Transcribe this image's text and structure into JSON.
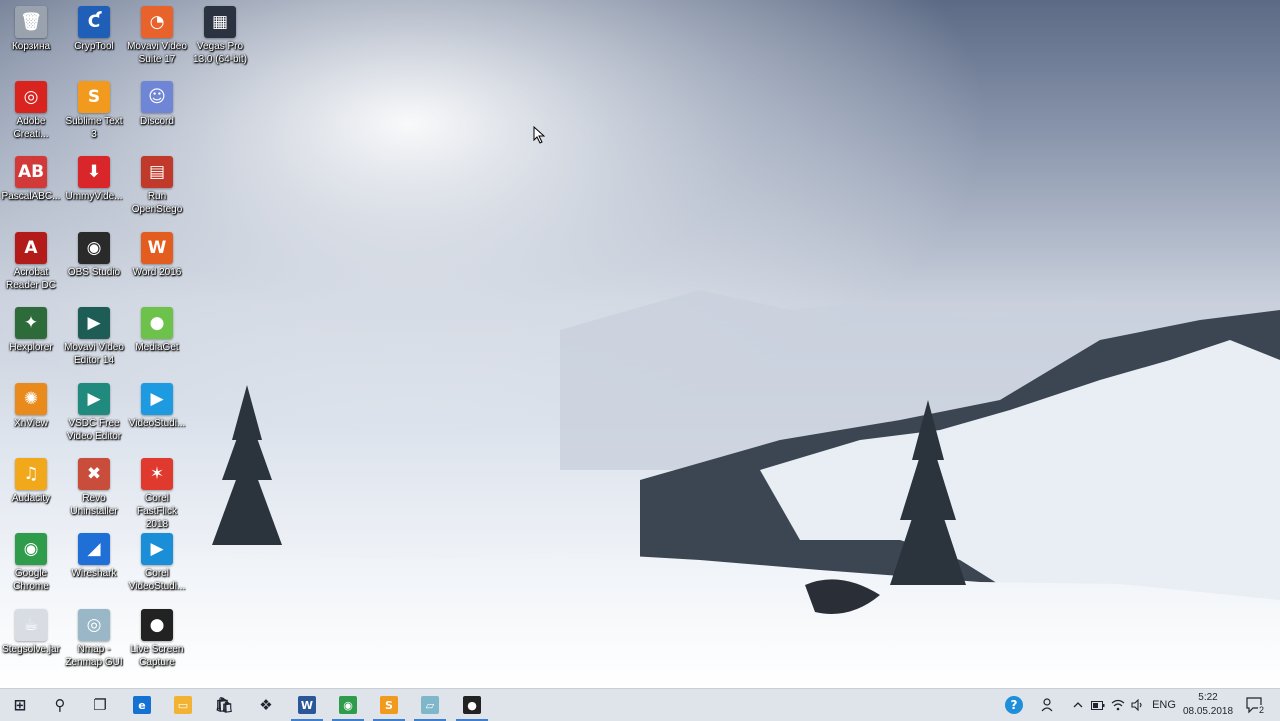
{
  "desktop": {
    "icons": [
      {
        "label": "Корзина",
        "glyph": "🗑",
        "color": "#9aa3ad",
        "icon": "recycle-bin-icon"
      },
      {
        "label": "CrypTool",
        "glyph": "Ƈ",
        "color": "#1f5fb8",
        "icon": "cryptool-icon"
      },
      {
        "label": "Movavi Video Suite 17",
        "glyph": "◔",
        "color": "#e8632c",
        "icon": "movavi-suite-icon"
      },
      {
        "label": "Vegas Pro 13.0 (64-bit)",
        "glyph": "▦",
        "color": "#2b3340",
        "icon": "vegas-pro-icon"
      },
      {
        "label": "Adobe Creati...",
        "glyph": "◎",
        "color": "#d9231f",
        "icon": "adobe-cc-icon"
      },
      {
        "label": "Sublime Text 3",
        "glyph": "S",
        "color": "#f29a1d",
        "icon": "sublime-text-icon"
      },
      {
        "label": "Discord",
        "glyph": "☺",
        "color": "#6f86d6",
        "icon": "discord-icon"
      },
      {
        "label": "PascalABC...",
        "glyph": "AB",
        "color": "#d23a3a",
        "icon": "pascalabc-icon"
      },
      {
        "label": "UmmyVide...",
        "glyph": "⬇",
        "color": "#d8262b",
        "icon": "ummy-video-icon"
      },
      {
        "label": "Run OpenStego",
        "glyph": "▤",
        "color": "#c0392b",
        "icon": "openstego-icon"
      },
      {
        "label": "Acrobat Reader DC",
        "glyph": "A",
        "color": "#b31b1b",
        "icon": "acrobat-reader-icon"
      },
      {
        "label": "OBS Studio",
        "glyph": "◉",
        "color": "#2a2a2a",
        "icon": "obs-studio-icon"
      },
      {
        "label": "Word 2016",
        "glyph": "W",
        "color": "#e25d1f",
        "icon": "office-word-icon"
      },
      {
        "label": "Hexplorer",
        "glyph": "✦",
        "color": "#2e6b3a",
        "icon": "hexplorer-icon"
      },
      {
        "label": "Movavi Video Editor 14",
        "glyph": "▶",
        "color": "#1e5d56",
        "icon": "movavi-editor-icon"
      },
      {
        "label": "MediaGet",
        "glyph": "●",
        "color": "#6cc24a",
        "icon": "mediaget-icon"
      },
      {
        "label": "XnView",
        "glyph": "✺",
        "color": "#e88a1c",
        "icon": "xnview-icon"
      },
      {
        "label": "VSDC Free Video Editor",
        "glyph": "▶",
        "color": "#1f8a7d",
        "icon": "vsdc-icon"
      },
      {
        "label": "VideoStudi...",
        "glyph": "▶",
        "color": "#1e9be0",
        "icon": "videostudio-icon"
      },
      {
        "label": "Audacity",
        "glyph": "♫",
        "color": "#f1a81b",
        "icon": "audacity-icon"
      },
      {
        "label": "Revo Uninstaller",
        "glyph": "✖",
        "color": "#c84d3a",
        "icon": "revo-uninstaller-icon"
      },
      {
        "label": "Corel FastFlick 2018",
        "glyph": "✶",
        "color": "#e03a2e",
        "icon": "corel-fastflick-icon"
      },
      {
        "label": "Google Chrome",
        "glyph": "◉",
        "color": "#2f9c4b",
        "icon": "chrome-icon"
      },
      {
        "label": "Wireshark",
        "glyph": "◢",
        "color": "#1f6fd6",
        "icon": "wireshark-icon"
      },
      {
        "label": "Corel VideoStudi...",
        "glyph": "▶",
        "color": "#1a8fd8",
        "icon": "corel-videostudio-icon"
      },
      {
        "label": "Stegsolve.jar",
        "glyph": "☕",
        "color": "#d8dde3",
        "icon": "java-jar-icon"
      },
      {
        "label": "Nmap - Zenmap GUI",
        "glyph": "◎",
        "color": "#9ab7c8",
        "icon": "zenmap-icon"
      },
      {
        "label": "Live Screen Capture",
        "glyph": "●",
        "color": "#222222",
        "icon": "live-screen-capture-icon"
      }
    ]
  },
  "taskbar": {
    "pinned": [
      {
        "name": "start",
        "glyph": "⊞",
        "color": "transparent",
        "icon": "windows-start-icon"
      },
      {
        "name": "search",
        "glyph": "⚲",
        "color": "transparent",
        "icon": "search-icon"
      },
      {
        "name": "task-view",
        "glyph": "❐",
        "color": "transparent",
        "icon": "task-view-icon"
      },
      {
        "name": "edge",
        "glyph": "e",
        "color": "#1572d3",
        "icon": "edge-icon"
      },
      {
        "name": "file-explorer",
        "glyph": "▭",
        "color": "#f2b233",
        "icon": "folder-icon"
      },
      {
        "name": "store",
        "glyph": "🛍",
        "color": "transparent",
        "icon": "store-icon"
      },
      {
        "name": "dropbox",
        "glyph": "❖",
        "color": "transparent",
        "icon": "dropbox-icon"
      },
      {
        "name": "word",
        "glyph": "W",
        "color": "#2b579a",
        "icon": "word-icon"
      },
      {
        "name": "chrome",
        "glyph": "◉",
        "color": "#2f9c4b",
        "icon": "chrome-icon"
      },
      {
        "name": "sublime",
        "glyph": "S",
        "color": "#f29a1d",
        "icon": "sublime-text-icon"
      },
      {
        "name": "notepad",
        "glyph": "▱",
        "color": "#7fb6c9",
        "icon": "notepad-icon"
      },
      {
        "name": "live-screen-capture",
        "glyph": "●",
        "color": "#222222",
        "icon": "screen-capture-icon"
      }
    ],
    "tray": {
      "language": "ENG",
      "time": "5:22",
      "date": "08.05.2018",
      "notification_count": "2"
    }
  }
}
